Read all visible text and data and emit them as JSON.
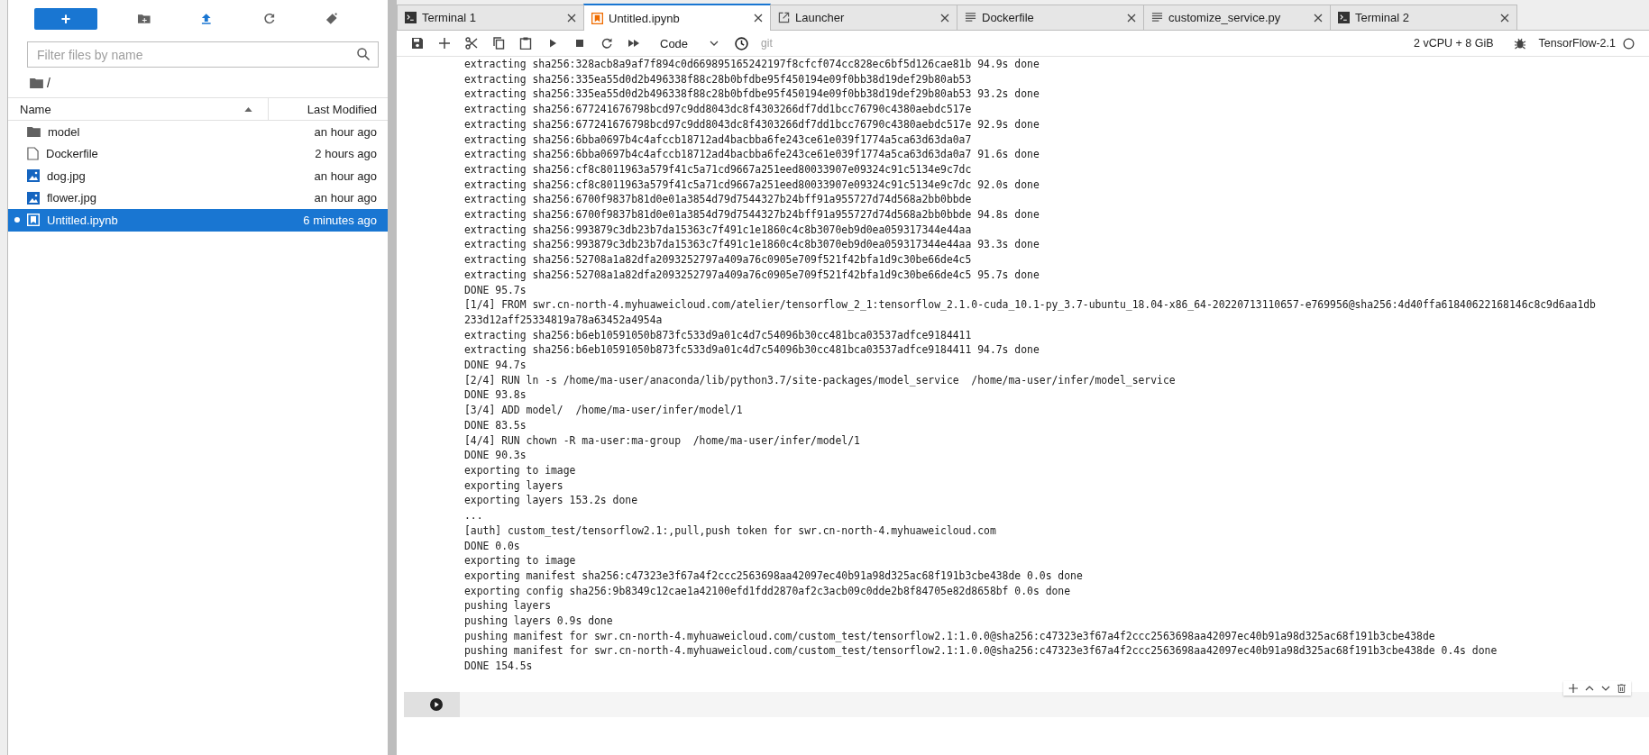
{
  "file_browser": {
    "new_button": "+",
    "filter": {
      "placeholder": "Filter files by name"
    },
    "breadcrumb": "/",
    "columns": [
      {
        "label": "Name",
        "sorted": true
      },
      {
        "label": "Last Modified",
        "sorted": false
      }
    ],
    "files": [
      {
        "kind": "folder",
        "name": "model",
        "modified": "an hour ago",
        "selected": false,
        "running": false
      },
      {
        "kind": "file",
        "name": "Dockerfile",
        "modified": "2 hours ago",
        "selected": false,
        "running": false
      },
      {
        "kind": "image",
        "name": "dog.jpg",
        "modified": "an hour ago",
        "selected": false,
        "running": false
      },
      {
        "kind": "image",
        "name": "flower.jpg",
        "modified": "an hour ago",
        "selected": false,
        "running": false
      },
      {
        "kind": "notebook",
        "name": "Untitled.ipynb",
        "modified": "6 minutes ago",
        "selected": true,
        "running": true
      }
    ]
  },
  "tabs": [
    {
      "kind": "terminal",
      "label": "Terminal 1",
      "selected": false
    },
    {
      "kind": "notebook",
      "label": "Untitled.ipynb",
      "selected": true
    },
    {
      "kind": "launcher",
      "label": "Launcher",
      "selected": false
    },
    {
      "kind": "file",
      "label": "Dockerfile",
      "selected": false
    },
    {
      "kind": "file",
      "label": "customize_service.py",
      "selected": false
    },
    {
      "kind": "terminal",
      "label": "Terminal 2",
      "selected": false
    }
  ],
  "toolbar": {
    "cell_type": "Code",
    "git": "git",
    "resources": "2 vCPU + 8 GiB",
    "kernel": "TensorFlow-2.1",
    "kernel_busy": false
  },
  "output": [
    "extracting sha256:328acb8a9af7f894c0d669895165242197f8cfcf074cc828ec6bf5d126cae81b 94.9s done",
    "extracting sha256:335ea55d0d2b496338f88c28b0bfdbe95f450194e09f0bb38d19def29b80ab53",
    "extracting sha256:335ea55d0d2b496338f88c28b0bfdbe95f450194e09f0bb38d19def29b80ab53 93.2s done",
    "extracting sha256:677241676798bcd97c9dd8043dc8f4303266df7dd1bcc76790c4380aebdc517e",
    "extracting sha256:677241676798bcd97c9dd8043dc8f4303266df7dd1bcc76790c4380aebdc517e 92.9s done",
    "extracting sha256:6bba0697b4c4afccb18712ad4bacbba6fe243ce61e039f1774a5ca63d63da0a7",
    "extracting sha256:6bba0697b4c4afccb18712ad4bacbba6fe243ce61e039f1774a5ca63d63da0a7 91.6s done",
    "extracting sha256:cf8c8011963a579f41c5a71cd9667a251eed80033907e09324c91c5134e9c7dc",
    "extracting sha256:cf8c8011963a579f41c5a71cd9667a251eed80033907e09324c91c5134e9c7dc 92.0s done",
    "extracting sha256:6700f9837b81d0e01a3854d79d7544327b24bff91a955727d74d568a2bb0bbde",
    "extracting sha256:6700f9837b81d0e01a3854d79d7544327b24bff91a955727d74d568a2bb0bbde 94.8s done",
    "extracting sha256:993879c3db23b7da15363c7f491c1e1860c4c8b3070eb9d0ea059317344e44aa",
    "extracting sha256:993879c3db23b7da15363c7f491c1e1860c4c8b3070eb9d0ea059317344e44aa 93.3s done",
    "extracting sha256:52708a1a82dfa2093252797a409a76c0905e709f521f42bfa1d9c30be66de4c5",
    "extracting sha256:52708a1a82dfa2093252797a409a76c0905e709f521f42bfa1d9c30be66de4c5 95.7s done",
    "DONE 95.7s",
    "[1/4] FROM swr.cn-north-4.myhuaweicloud.com/atelier/tensorflow_2_1:tensorflow_2.1.0-cuda_10.1-py_3.7-ubuntu_18.04-x86_64-20220713110657-e769956@sha256:4d40ffa61840622168146c8c9d6aa1db",
    "233d12aff25334819a78a63452a4954a",
    "extracting sha256:b6eb10591050b873fc533d9a01c4d7c54096b30cc481bca03537adfce9184411",
    "extracting sha256:b6eb10591050b873fc533d9a01c4d7c54096b30cc481bca03537adfce9184411 94.7s done",
    "DONE 94.7s",
    "[2/4] RUN ln -s /home/ma-user/anaconda/lib/python3.7/site-packages/model_service  /home/ma-user/infer/model_service",
    "DONE 93.8s",
    "[3/4] ADD model/  /home/ma-user/infer/model/1",
    "DONE 83.5s",
    "[4/4] RUN chown -R ma-user:ma-group  /home/ma-user/infer/model/1",
    "DONE 90.3s",
    "exporting to image",
    "exporting layers",
    "exporting layers 153.2s done",
    "...",
    "[auth] custom_test/tensorflow2.1:,pull,push token for swr.cn-north-4.myhuaweicloud.com",
    "DONE 0.0s",
    "exporting to image",
    "exporting manifest sha256:c47323e3f67a4f2ccc2563698aa42097ec40b91a98d325ac68f191b3cbe438de 0.0s done",
    "exporting config sha256:9b8349c12cae1a42100efd1fdd2870af2c3acb09c0dde2b8f84705e82d8658bf 0.0s done",
    "pushing layers",
    "pushing layers 0.9s done",
    "pushing manifest for swr.cn-north-4.myhuaweicloud.com/custom_test/tensorflow2.1:1.0.0@sha256:c47323e3f67a4f2ccc2563698aa42097ec40b91a98d325ac68f191b3cbe438de",
    "pushing manifest for swr.cn-north-4.myhuaweicloud.com/custom_test/tensorflow2.1:1.0.0@sha256:c47323e3f67a4f2ccc2563698aa42097ec40b91a98d325ac68f191b3cbe438de 0.4s done",
    "DONE 154.5s"
  ]
}
